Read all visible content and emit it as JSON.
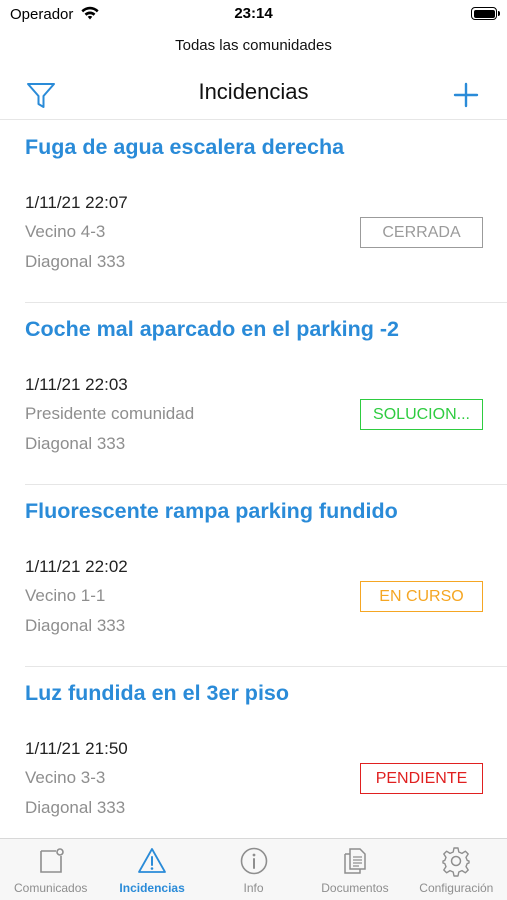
{
  "status_bar": {
    "carrier": "Operador",
    "time": "23:14"
  },
  "header": {
    "community": "Todas las comunidades",
    "title": "Incidencias"
  },
  "colors": {
    "accent": "#2a8bd8",
    "closed": "#9b9b9b",
    "solving": "#2ecc40",
    "in_progress": "#f5a623",
    "pending": "#e02020"
  },
  "incidents": [
    {
      "title": "Fuga de agua escalera derecha",
      "date": "1/11/21 22:07",
      "author": "Vecino 4-3",
      "address": "Diagonal 333",
      "status": "CERRADA",
      "status_color": "#9b9b9b"
    },
    {
      "title": "Coche mal aparcado en el parking -2",
      "date": "1/11/21 22:03",
      "author": "Presidente comunidad",
      "address": "Diagonal 333",
      "status": "SOLUCION...",
      "status_color": "#2ecc40"
    },
    {
      "title": "Fluorescente rampa parking fundido",
      "date": "1/11/21 22:02",
      "author": "Vecino 1-1",
      "address": "Diagonal 333",
      "status": "EN CURSO",
      "status_color": "#f5a623"
    },
    {
      "title": "Luz fundida en el 3er piso",
      "date": "1/11/21 21:50",
      "author": "Vecino 3-3",
      "address": "Diagonal 333",
      "status": "PENDIENTE",
      "status_color": "#e02020"
    }
  ],
  "tabs": [
    {
      "label": "Comunicados",
      "icon": "note-icon",
      "active": false
    },
    {
      "label": "Incidencias",
      "icon": "warning-icon",
      "active": true
    },
    {
      "label": "Info",
      "icon": "info-icon",
      "active": false
    },
    {
      "label": "Documentos",
      "icon": "documents-icon",
      "active": false
    },
    {
      "label": "Configuración",
      "icon": "gear-icon",
      "active": false
    }
  ]
}
